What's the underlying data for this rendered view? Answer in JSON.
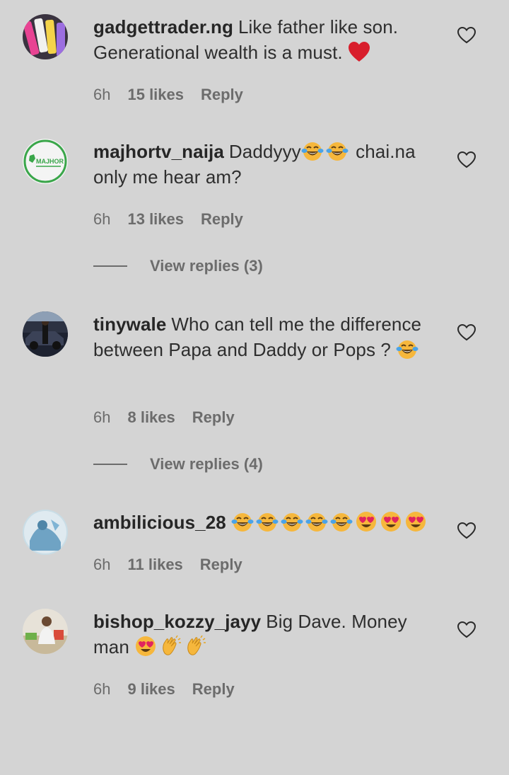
{
  "comments": [
    {
      "username": "gadgettrader.ng",
      "text": "Like father like son. Generational wealth is a must.",
      "emojis": [
        "red-heart"
      ],
      "time": "6h",
      "likes": "15 likes",
      "reply": "Reply"
    },
    {
      "username": "majhortv_naija",
      "text_before": "Daddyyy",
      "text_after": " chai.na only me hear am?",
      "emojis": [
        "tears-of-joy",
        "tears-of-joy"
      ],
      "avatar_text": "MAJHOR",
      "time": "6h",
      "likes": "13 likes",
      "reply": "Reply",
      "view_replies": "View replies (3)"
    },
    {
      "username": "tinywale",
      "text": "Who can tell me the difference between Papa and Daddy or Pops ?",
      "emojis": [
        "tears-of-joy"
      ],
      "time": "6h",
      "likes": "8 likes",
      "reply": "Reply",
      "view_replies": "View replies (4)"
    },
    {
      "username": "ambilicious_28",
      "emojis": [
        "tears-of-joy",
        "tears-of-joy",
        "tears-of-joy",
        "tears-of-joy",
        "tears-of-joy",
        "heart-eyes",
        "heart-eyes",
        "heart-eyes"
      ],
      "time": "6h",
      "likes": "11 likes",
      "reply": "Reply"
    },
    {
      "username": "bishop_kozzy_jayy",
      "text": "Big Dave. Money man",
      "emojis": [
        "heart-eyes",
        "clapping-hands",
        "clapping-hands"
      ],
      "time": "6h",
      "likes": "9 likes",
      "reply": "Reply"
    }
  ],
  "colors": {
    "background": "#d4d4d4",
    "text": "#2e2e2e",
    "meta": "#6c6c6c",
    "heart": "#d81e2c",
    "emoji_yellow": "#f6b73c",
    "avatar_ring": "#3aa64a"
  },
  "icons": {
    "like": "heart-outline-icon"
  }
}
